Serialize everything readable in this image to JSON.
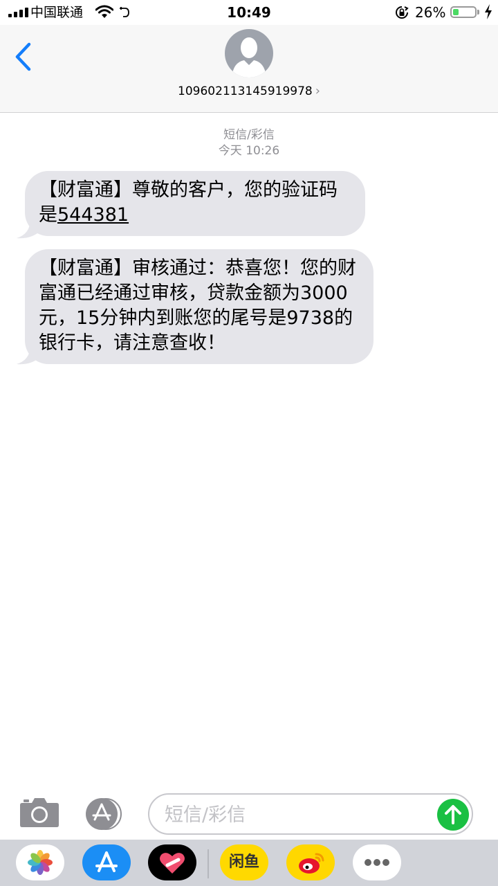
{
  "status_bar": {
    "carrier": "中国联通",
    "time": "10:49",
    "battery_percent": "26%",
    "battery_level": 0.26,
    "charging": true
  },
  "header": {
    "contact_number": "109602113145919978",
    "chevron": "›"
  },
  "thread": {
    "message_type_label": "短信/彩信",
    "timestamp": "今天 10:26",
    "messages": [
      {
        "direction": "incoming",
        "text_before_code": "【财富通】尊敬的客户，您的验证码是",
        "code": "544381"
      },
      {
        "direction": "incoming",
        "text": "【财富通】审核通过：恭喜您！您的财富通已经通过审核，贷款金额为3000元，15分钟内到账您的尾号是9738的银行卡，请注意查收！"
      }
    ]
  },
  "input_bar": {
    "placeholder": "短信/彩信",
    "value": ""
  },
  "drawer": {
    "apps": [
      "photos-app-icon",
      "app-store-icon",
      "digital-touch-icon",
      "xianyu-app-icon",
      "weibo-app-icon",
      "more-apps-icon"
    ],
    "xianyu_label": "闲鱼"
  },
  "colors": {
    "accent_blue": "#147efb",
    "bubble_gray": "#e5e5ea",
    "send_green": "#1ac043",
    "battery_green": "#4cd964"
  }
}
